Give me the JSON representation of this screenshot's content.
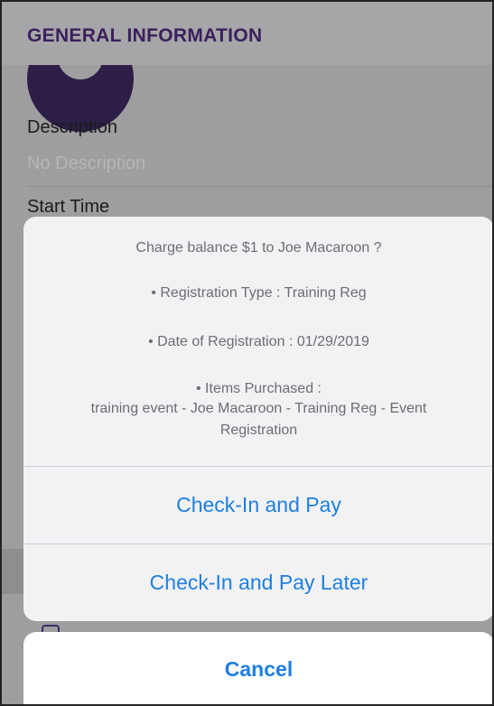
{
  "header": {
    "title": "GENERAL INFORMATION"
  },
  "event": {
    "description_label": "Description",
    "description_value": "No Description",
    "start_time_label": "Start Time"
  },
  "action_sheet": {
    "message_lines": [
      "Charge balance $1 to Joe Macaroon ?",
      "• Registration Type : Training Reg",
      "• Date of Registration : 01/29/2019",
      "• Items Purchased :",
      "training event - Joe Macaroon  - Training Reg - Event",
      "Registration"
    ],
    "checkin_pay_label": "Check-In and Pay",
    "checkin_pay_later_label": "Check-In and Pay Later",
    "cancel_label": "Cancel"
  },
  "colors": {
    "accent": "#1e7fe0",
    "header_text": "#3b1f5d",
    "avatar": "#2d1e47"
  }
}
